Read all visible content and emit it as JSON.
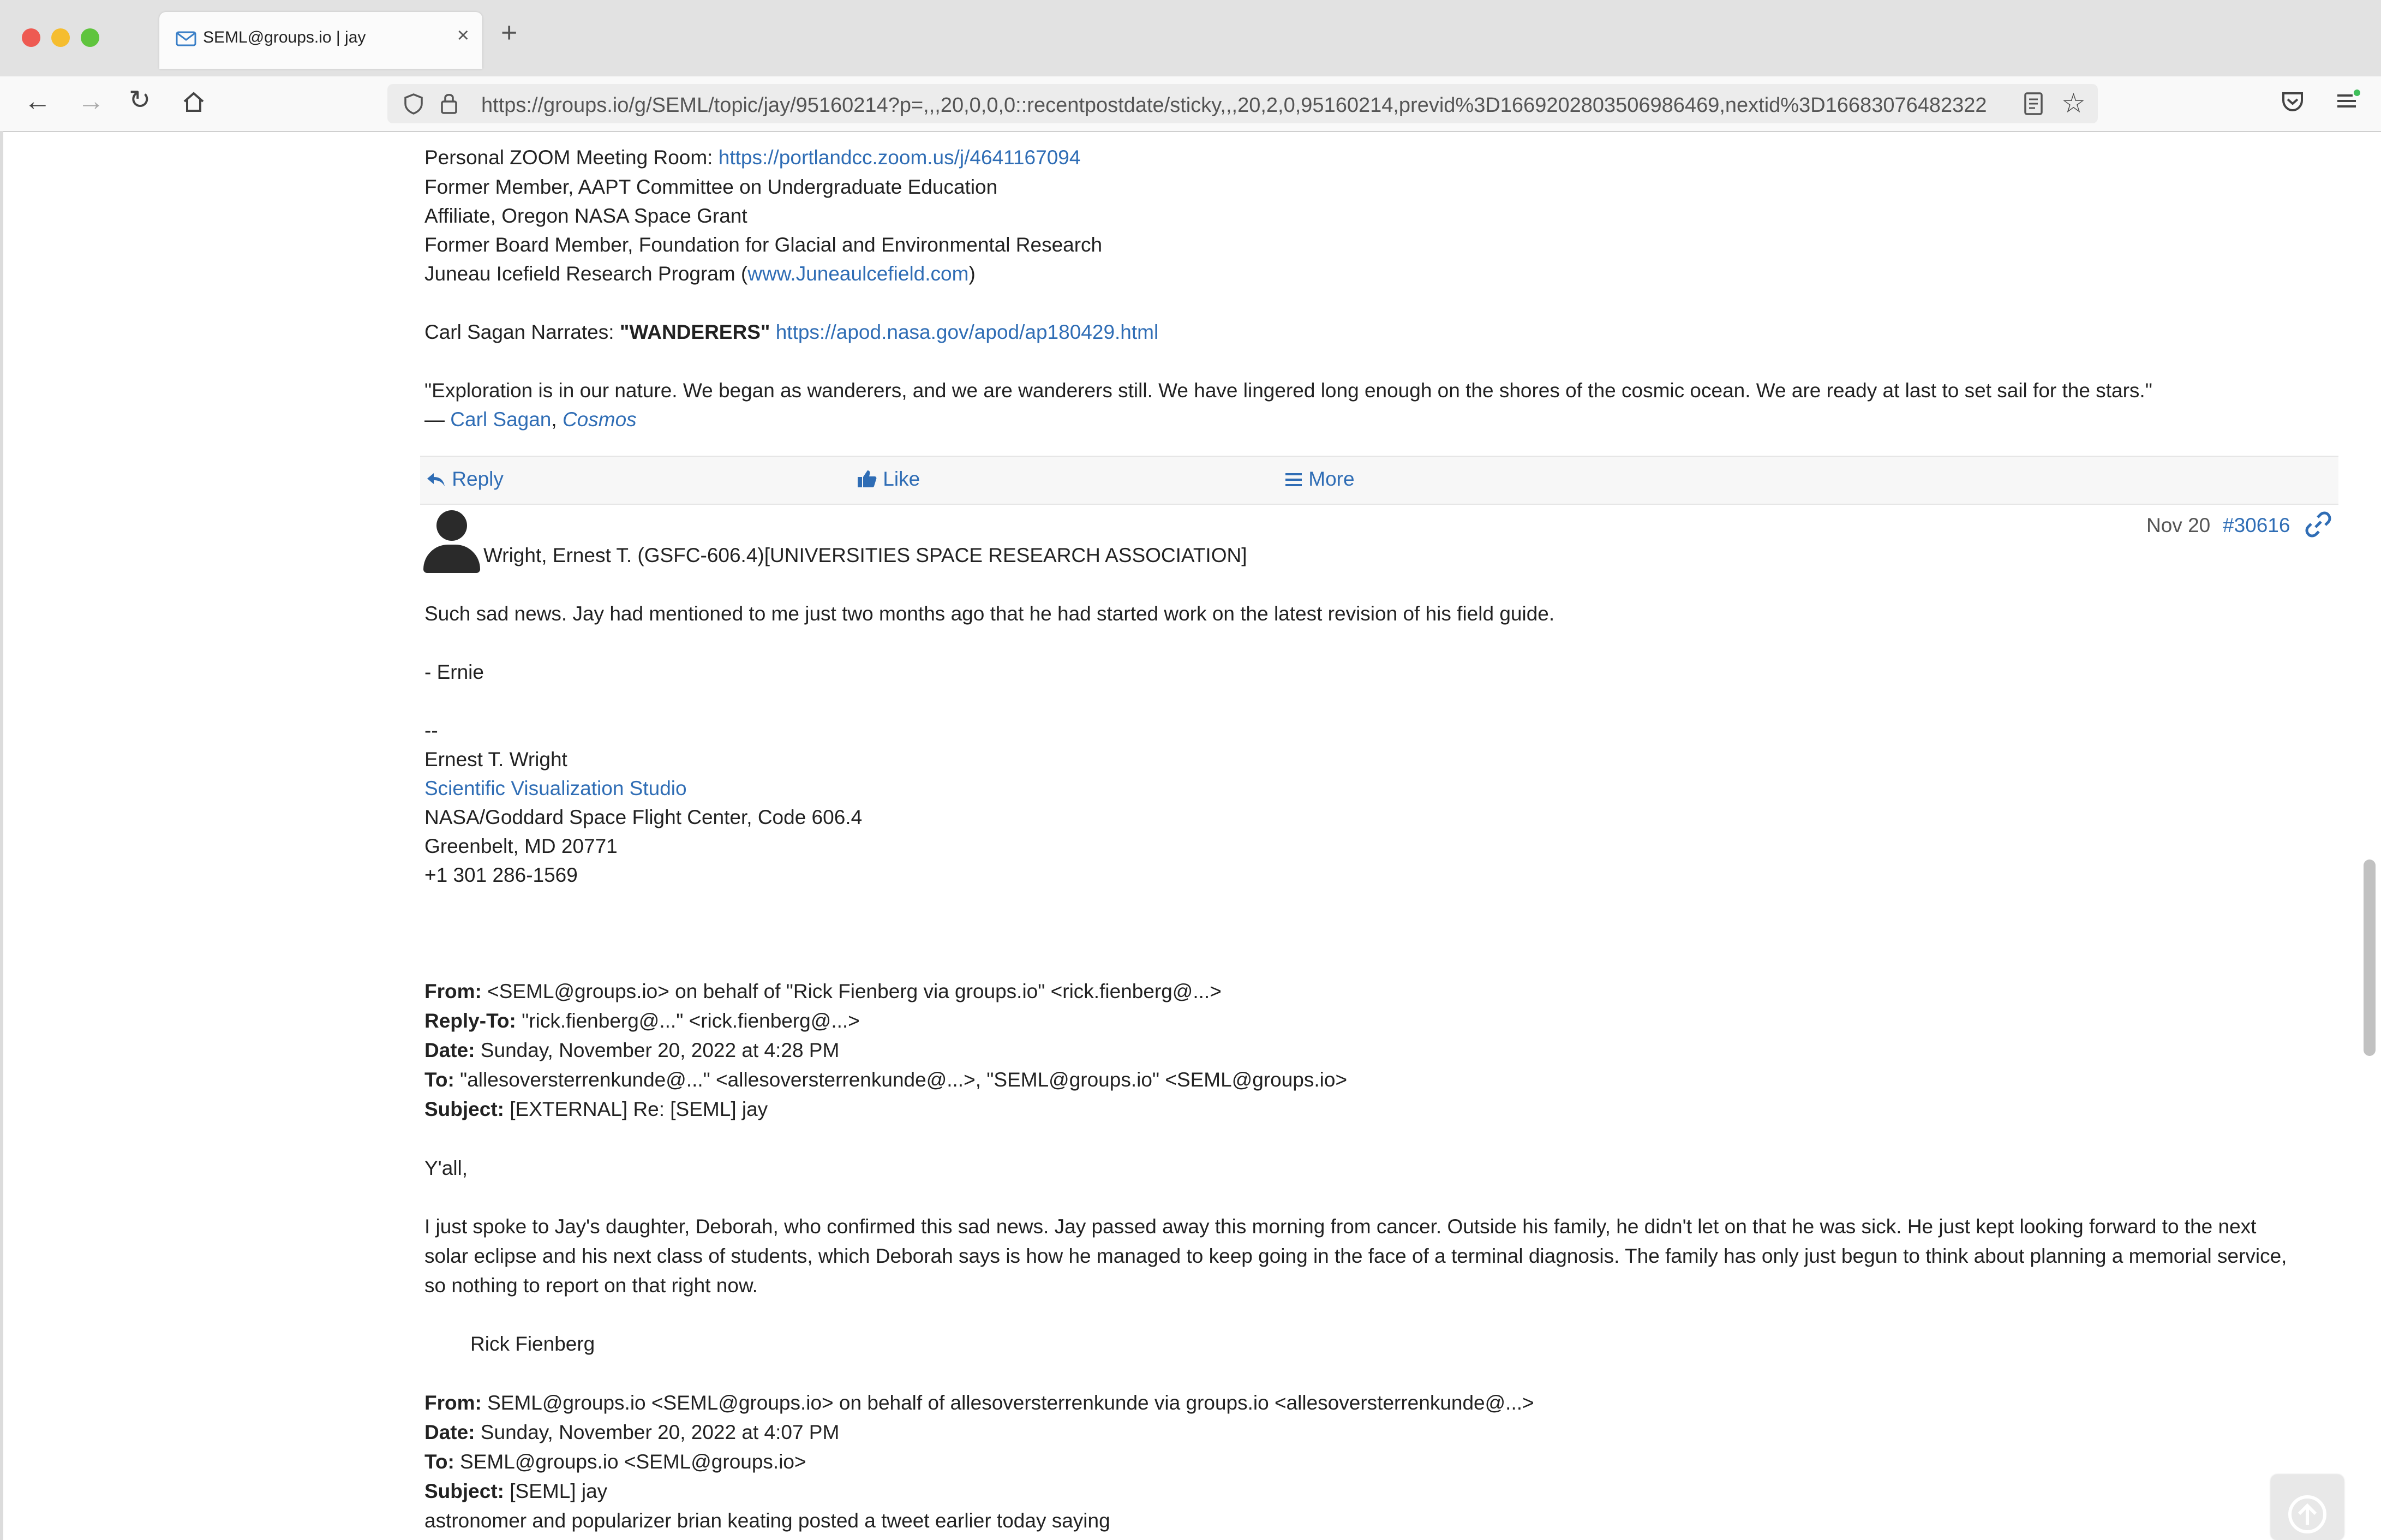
{
  "browser": {
    "tab_title": "SEML@groups.io | jay",
    "tab_close": "×",
    "new_tab": "+",
    "url": "https://groups.io/g/SEML/topic/jay/95160214?p=,,,20,0,0,0::recentpostdate/sticky,,,20,2,0,95160214,previd%3D1669202803506986469,nextid%3D16683076482322"
  },
  "previous_signature": {
    "zoom_label": "Personal ZOOM Meeting Room: ",
    "zoom_link": "https://portlandcc.zoom.us/j/4641167094",
    "line2": "Former Member, AAPT Committee on Undergraduate Education",
    "line3": "Affiliate, Oregon NASA Space Grant",
    "line4": "Former Board Member, Foundation for Glacial and Environmental Research",
    "line5_prefix": "Juneau Icefield Research Program (",
    "line5_link": "www.Juneaulcefield.com",
    "line5_suffix": ")",
    "sagan_prefix": " Carl Sagan Narrates: ",
    "sagan_bold": "\"WANDERERS\"",
    "sagan_link": "https://apod.nasa.gov/apod/ap180429.html",
    "quote": "\"Exploration is in our nature. We began as wanderers, and we are wanderers still. We have lingered long enough on the shores of the cosmic ocean. We are ready at last to set sail for the stars.\"",
    "quote_dash": "— ",
    "quote_author": "Carl Sagan",
    "quote_sep": ", ",
    "quote_work": "Cosmos"
  },
  "actions": {
    "reply": "Reply",
    "like": "Like",
    "more": "More"
  },
  "message": {
    "sender": "Wright, Ernest T. (GSFC-606.4)[UNIVERSITIES SPACE RESEARCH ASSOCIATION]",
    "date": "Nov 20",
    "msg_number": "#30616",
    "body1": "Such sad news. Jay had mentioned to me just two months ago that he had started work on the latest revision of his field guide.",
    "body2": "- Ernie",
    "sig_dash": "--",
    "sig_name": "Ernest T. Wright",
    "sig_link": "Scientific Visualization Studio",
    "sig_line3": "NASA/Goddard Space Flight Center, Code 606.4",
    "sig_line4": "Greenbelt, MD 20771",
    "sig_line5": "+1 301 286-1569"
  },
  "quoted1": {
    "from_label": "From:",
    "from_value": " <SEML@groups.io> on behalf of \"Rick Fienberg via groups.io\" <rick.fienberg@...>",
    "replyto_label": "Reply-To:",
    "replyto_value": " \"rick.fienberg@...\" <rick.fienberg@...>",
    "date_label": "Date:",
    "date_value": " Sunday, November 20, 2022 at 4:28 PM",
    "to_label": "To:",
    "to_value": " \"allesoversterrenkunde@...\" <allesoversterrenkunde@...>, \"SEML@groups.io\" <SEML@groups.io>",
    "subject_label": "Subject:",
    "subject_value": " [EXTERNAL] Re: [SEML] jay",
    "greeting": "Y'all,",
    "para1": "I just spoke to Jay's daughter, Deborah, who confirmed this sad news. Jay passed away this morning from cancer. Outside his family, he didn't let on that he was sick. He just kept looking forward to the next",
    "para2": "solar eclipse and his next class of students, which Deborah says is how he managed to keep going in the face of a terminal diagnosis. The family has only just begun to think about planning a memorial service,",
    "para3": "so nothing to report on that right now.",
    "signoff": "Rick Fienberg"
  },
  "quoted2": {
    "from_label": "From:",
    "from_value": " SEML@groups.io <SEML@groups.io> on behalf of allesoversterrenkunde via groups.io <allesoversterrenkunde@...>",
    "date_label": "Date:",
    "date_value": " Sunday, November 20, 2022 at 4:07 PM",
    "to_label": "To:",
    "to_value": " SEML@groups.io <SEML@groups.io>",
    "subject_label": "Subject:",
    "subject_value": " [SEML] jay",
    "body": "astronomer and popularizer brian keating posted a tweet earlier today saying"
  }
}
